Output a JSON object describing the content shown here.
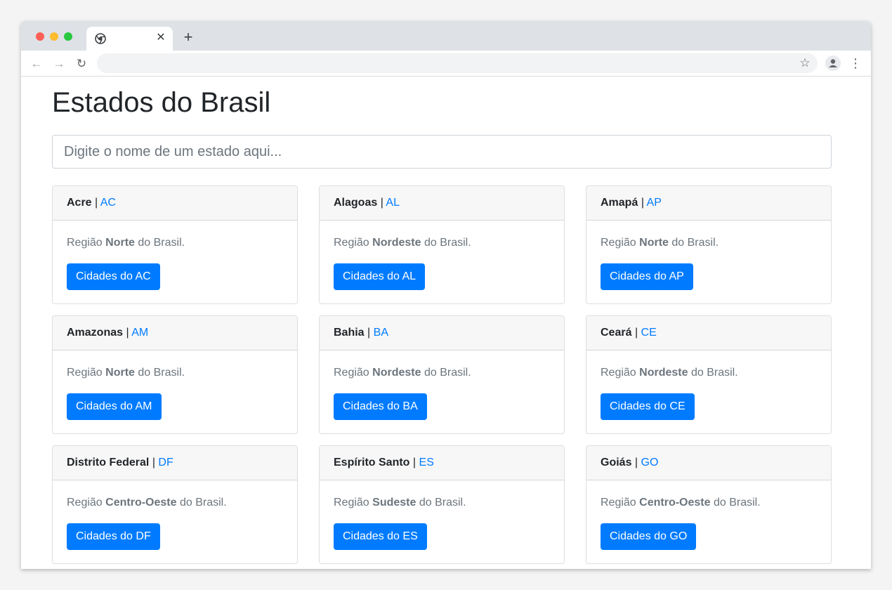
{
  "browser": {
    "tab_title": "",
    "url": "",
    "close_tab_glyph": "✕",
    "new_tab_glyph": "+",
    "back_glyph": "←",
    "forward_glyph": "→",
    "reload_glyph": "↻",
    "star_glyph": "☆",
    "menu_glyph": "⋮"
  },
  "page": {
    "title": "Estados do Brasil",
    "search_placeholder": "Digite o nome de um estado aqui...",
    "region_prefix": "Região",
    "region_suffix": "do Brasil.",
    "separator": "|"
  },
  "states": [
    {
      "name": "Acre",
      "uf": "AC",
      "region": "Norte",
      "button": "Cidades do AC"
    },
    {
      "name": "Alagoas",
      "uf": "AL",
      "region": "Nordeste",
      "button": "Cidades do AL"
    },
    {
      "name": "Amapá",
      "uf": "AP",
      "region": "Norte",
      "button": "Cidades do AP"
    },
    {
      "name": "Amazonas",
      "uf": "AM",
      "region": "Norte",
      "button": "Cidades do AM"
    },
    {
      "name": "Bahia",
      "uf": "BA",
      "region": "Nordeste",
      "button": "Cidades do BA"
    },
    {
      "name": "Ceará",
      "uf": "CE",
      "region": "Nordeste",
      "button": "Cidades do CE"
    },
    {
      "name": "Distrito Federal",
      "uf": "DF",
      "region": "Centro-Oeste",
      "button": "Cidades do DF"
    },
    {
      "name": "Espírito Santo",
      "uf": "ES",
      "region": "Sudeste",
      "button": "Cidades do ES"
    },
    {
      "name": "Goiás",
      "uf": "GO",
      "region": "Centro-Oeste",
      "button": "Cidades do GO"
    }
  ],
  "colors": {
    "primary": "#007bff",
    "card_header_bg": "#f7f7f7",
    "muted_text": "#6c757d"
  }
}
